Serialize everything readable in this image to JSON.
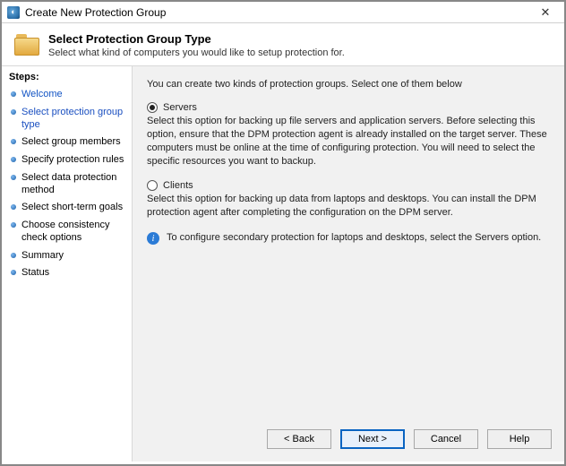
{
  "window": {
    "title": "Create New Protection Group"
  },
  "header": {
    "title": "Select Protection Group Type",
    "subtitle": "Select what kind of computers you would like to setup protection for."
  },
  "sidebar": {
    "title": "Steps:",
    "items": [
      {
        "label": "Welcome",
        "state": "link"
      },
      {
        "label": "Select protection group type",
        "state": "active"
      },
      {
        "label": "Select group members",
        "state": "normal"
      },
      {
        "label": "Specify protection rules",
        "state": "normal"
      },
      {
        "label": "Select data protection method",
        "state": "normal"
      },
      {
        "label": "Select short-term goals",
        "state": "normal"
      },
      {
        "label": "Choose consistency check options",
        "state": "normal"
      },
      {
        "label": "Summary",
        "state": "normal"
      },
      {
        "label": "Status",
        "state": "normal"
      }
    ]
  },
  "content": {
    "intro": "You can create two kinds of protection groups. Select one of them below",
    "options": [
      {
        "label": "Servers",
        "selected": true,
        "description": "Select this option for backing up file servers and application servers. Before selecting this option, ensure that the DPM protection agent is already installed on the target server. These computers must be online at the time of configuring protection. You will need to select the specific resources you want to backup."
      },
      {
        "label": "Clients",
        "selected": false,
        "description": "Select this option for backing up data from laptops and desktops. You can install the DPM protection agent after completing the configuration on the DPM server."
      }
    ],
    "info": "To configure secondary protection for laptops and desktops, select the Servers option."
  },
  "buttons": {
    "back": "< Back",
    "next": "Next >",
    "cancel": "Cancel",
    "help": "Help"
  }
}
